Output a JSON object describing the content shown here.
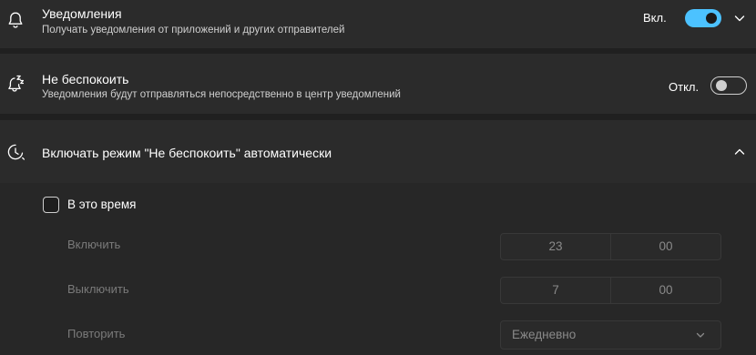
{
  "notifications": {
    "title": "Уведомления",
    "subtitle": "Получать уведомления от приложений и других отправителей",
    "state_label": "Вкл.",
    "enabled": true,
    "icon": "bell-icon"
  },
  "do_not_disturb": {
    "title": "Не беспокоить",
    "subtitle": "Уведомления будут отправляться непосредственно в центр уведомлений",
    "state_label": "Откл.",
    "enabled": false,
    "icon": "bell-zzz-icon"
  },
  "auto_dnd": {
    "title": "Включать режим \"Не беспокоить\" автоматически",
    "expanded": true,
    "icon": "clock-icon",
    "during_time": {
      "label": "В это время",
      "checked": false
    },
    "turn_on": {
      "label": "Включить",
      "hour": "23",
      "minute": "00"
    },
    "turn_off": {
      "label": "Выключить",
      "hour": "7",
      "minute": "00"
    },
    "repeat": {
      "label": "Повторить",
      "value": "Ежедневно"
    }
  },
  "colors": {
    "background": "#202020",
    "card": "#2b2b2b",
    "accent": "#4cc2ff",
    "disabled_text": "#7a7a7a"
  }
}
